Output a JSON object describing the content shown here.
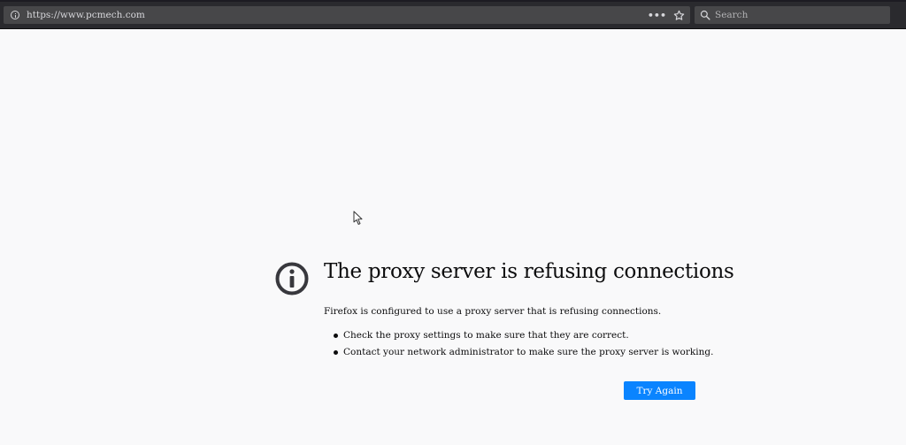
{
  "browser": {
    "url": "https://www.pcmech.com",
    "url_icon": "info-icon",
    "page_actions_label": "•••",
    "bookmark_icon": "star-icon",
    "search": {
      "placeholder": "Search",
      "value": "",
      "icon": "search-icon"
    }
  },
  "error": {
    "icon": "info-icon",
    "title": "The proxy server is refusing connections",
    "description": "Firefox is configured to use a proxy server that is refusing connections.",
    "tips": [
      "Check the proxy settings to make sure that they are correct.",
      "Contact your network administrator to make sure the proxy server is working."
    ],
    "try_again_label": "Try Again"
  },
  "colors": {
    "toolbar_bg": "#2a2a2e",
    "field_bg": "#474749",
    "page_bg": "#f9f9fa",
    "accent": "#0a84ff",
    "icon_color": "#38383d"
  }
}
